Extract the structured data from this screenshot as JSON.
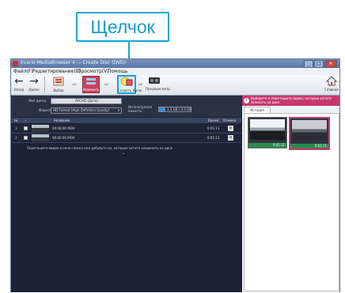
{
  "callout": {
    "label": "Щелчок"
  },
  "window": {
    "title": "Everio MediaBrowser 4 — Create Disc (DVD)",
    "controls": [
      "_",
      "□",
      "×"
    ]
  },
  "menu": {
    "items": [
      "Файл(F)",
      "Редактирование(E)",
      "Просмотр(V)",
      "Помощь"
    ]
  },
  "toolbar": {
    "back_label": "Назад",
    "forward_label": "Далее",
    "buttons": [
      {
        "label": "Выбор"
      },
      {
        "label": "Изменить"
      },
      {
        "label": "Создать меню"
      },
      {
        "label": "Предпросмотр"
      }
    ],
    "home_label": "Главная"
  },
  "info": {
    "disc_name_label": "Имя диска",
    "disc_name_value": "AVCHD (Дата)",
    "format_label": "Формат",
    "format_value": "HD Format (High Definition Quality)",
    "capacity_label": "Используемая ёмкость:",
    "capacity_value": "1.3 GB / 4.3 GB"
  },
  "table": {
    "columns": [
      "№",
      "✓",
      "Название",
      "Время",
      "Отмена"
    ],
    "rows": [
      {
        "num": "1",
        "name": "00:00:00 MOV",
        "duration": "0:01:11",
        "delete": "×"
      },
      {
        "num": "2",
        "name": "00:00:00 MOV",
        "duration": "0:01:11",
        "delete": "×"
      }
    ],
    "note": "Перетащите видео в окно списка или добавьте их, которые хотите сохранить на диск",
    "note_caret": "⌄"
  },
  "side_panel": {
    "tip_icon": "i",
    "tip_text": "Выберите и перетащите видео, которые хотите записать на диск",
    "tab_label": "История",
    "clips": [
      {
        "time": "0:01:11"
      },
      {
        "time": "0:01:11"
      }
    ]
  },
  "colors": {
    "accent": "#1aa3d6",
    "tip_bar": "#c5396d",
    "panel_bg": "#1b2234"
  }
}
